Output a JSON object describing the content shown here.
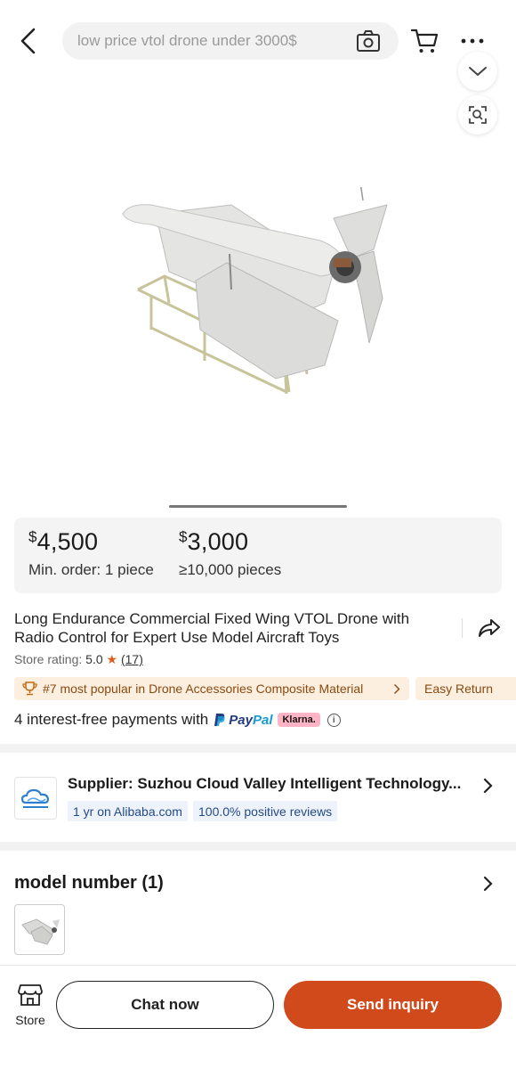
{
  "search": {
    "placeholder": "low price vtol drone under 3000$"
  },
  "icons": {
    "back": "chevron-left-icon",
    "camera": "camera-search-icon",
    "cart": "cart-icon",
    "more": "more-dots-icon",
    "collapse": "chevron-down-icon",
    "image_search": "image-search-icon",
    "share": "share-icon",
    "info": "info-icon",
    "trophy": "trophy-icon",
    "store": "store-icon"
  },
  "pricing": {
    "tiers": [
      {
        "currency": "$",
        "amount": "4,500",
        "qty": "Min. order: 1 piece"
      },
      {
        "currency": "$",
        "amount": "3,000",
        "qty": "≥10,000 pieces"
      }
    ]
  },
  "product": {
    "title": "Long Endurance Commercial Fixed Wing VTOL Drone with Radio Control for Expert Use Model Aircraft Toys",
    "rating_label": "Store rating:",
    "rating_value": "5.0",
    "rating_count": "(17)",
    "popular_tag": "#7 most popular in Drone Accessories Composite Material",
    "easy_return_tag": "Easy Return",
    "payments_text": "4 interest-free payments with",
    "paypal_a": "Pay",
    "paypal_b": "Pal",
    "klarna": "Klarna."
  },
  "supplier": {
    "name": "Supplier:  Suzhou Cloud Valley Intelligent Technology...",
    "tag_years": "1 yr on Alibaba.com",
    "tag_reviews": "100.0% positive reviews"
  },
  "model": {
    "title": "model number (1)"
  },
  "bottom": {
    "store_label": "Store",
    "chat_label": "Chat now",
    "inquiry_label": "Send inquiry"
  },
  "colors": {
    "accent": "#d04a1c",
    "tag_bg": "#fcefdf",
    "tag_text": "#8a4a10",
    "supplier_tag_bg": "#eef3fb",
    "supplier_tag_text": "#234b87"
  }
}
